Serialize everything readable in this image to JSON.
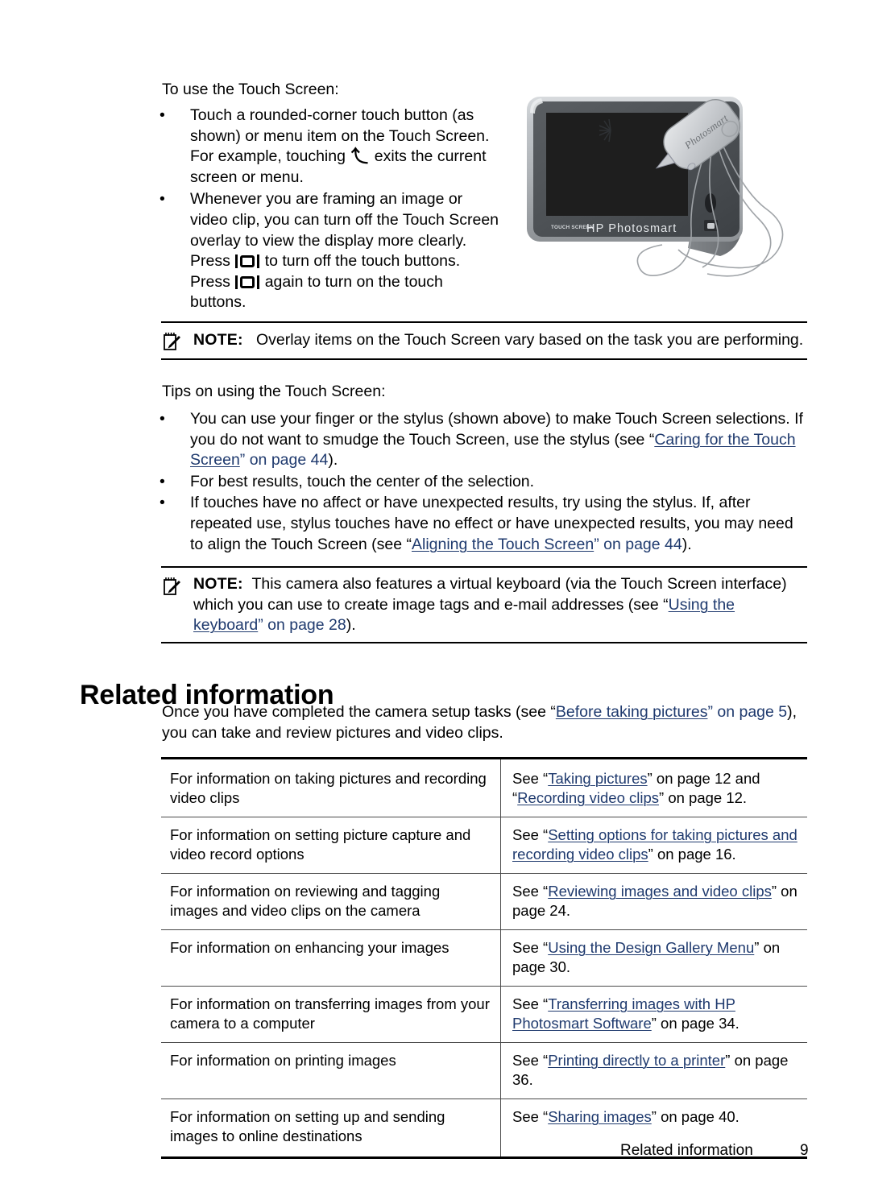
{
  "page": {
    "intro_line": "To use the Touch Screen:",
    "tips_line": "Tips on using the Touch Screen:"
  },
  "touch_screen_bullets": [
    {
      "part1": "Touch a rounded-corner touch button (as shown) or menu item on the Touch Screen. For example, touching",
      "icon": "back-arrow-icon",
      "part2": "exits the current screen or menu."
    },
    {
      "part1": "Whenever you are framing an image or video clip, you can turn off the Touch Screen overlay to view the display more clearly. Press",
      "icon": "display-toggle-icon",
      "part2": "to turn off the touch buttons. Press",
      "icon2": "display-toggle-icon",
      "part3": "again to turn on the touch buttons."
    }
  ],
  "notes": [
    {
      "label": "NOTE:",
      "text": "Overlay items on the Touch Screen vary based on the task you are performing."
    },
    {
      "label": "NOTE:",
      "text_part1": "This camera also features a virtual keyboard (via the Touch Screen interface) which you can use to create image tags and e-mail addresses (see “",
      "link": "Using the keyboard",
      "text_part2": "” on page ",
      "page": "28",
      "text_part3": ")."
    }
  ],
  "tips_bullets": [
    {
      "part1": "You can use your finger or the stylus (shown above) to make Touch Screen selections. If you do not want to smudge the Touch Screen, use the stylus (see “",
      "link": "Caring for the Touch Screen",
      "part2": "” on page ",
      "page": "44",
      "part3": ")."
    },
    {
      "part1": "For best results, touch the center of the selection."
    },
    {
      "part1": "If touches have no affect or have unexpected results, try using the stylus. If, after repeated use, stylus touches have no effect or have unexpected results, you may need to align the Touch Screen (see “",
      "link": "Aligning the Touch Screen",
      "part2": "” on page ",
      "page": "44",
      "part3": ")."
    }
  ],
  "related": {
    "heading": "Related information",
    "intro_part1": "Once you have completed the camera setup tasks (see “",
    "intro_link": "Before taking pictures",
    "intro_part2": "” on page ",
    "intro_page": "5",
    "intro_part3": "), you can take and review pictures and video clips."
  },
  "table": {
    "rows": [
      {
        "left": "For information on taking pictures and recording video clips",
        "right_prefix": "See “",
        "link1": "Taking pictures",
        "mid1": "” on page 12 and “",
        "link2": "Recording video clips",
        "suffix": "” on page 12."
      },
      {
        "left": "For information on setting picture capture and video record options",
        "right_prefix": "See “",
        "link1": "Setting options for taking pictures and recording video clips",
        "suffix": "” on page 16."
      },
      {
        "left": "For information on reviewing and tagging images and video clips on the camera",
        "right_prefix": "See “",
        "link1": "Reviewing images and video clips",
        "suffix": "” on page 24."
      },
      {
        "left": "For information on enhancing your images",
        "right_prefix": "See “",
        "link1": "Using the Design Gallery Menu",
        "suffix": "” on page 30."
      },
      {
        "left": "For information on transferring images from your camera to a computer",
        "right_prefix": "See “",
        "link1": "Transferring images with HP Photosmart Software",
        "suffix": "” on page 34."
      },
      {
        "left": "For information on printing images",
        "right_prefix": "See “",
        "link1": "Printing directly to a printer",
        "suffix": "” on page 36."
      },
      {
        "left": "For information on setting up and sending images to online destinations",
        "right_prefix": "See “",
        "link1": "Sharing images",
        "suffix": "” on page 40."
      }
    ]
  },
  "illustration": {
    "camera_brand": "HP Photosmart",
    "camera_touch_label": "TOUCH SCREEN",
    "stylus_label": "Photosmart"
  },
  "footer": {
    "chapter": "Related information",
    "page_number": "9"
  },
  "colors": {
    "link": "#1f3a6e",
    "rule": "#000000",
    "camera_bezel": "#b8bcc0",
    "camera_face": "#4a4e52",
    "camera_screen": "#1e1e1e"
  }
}
